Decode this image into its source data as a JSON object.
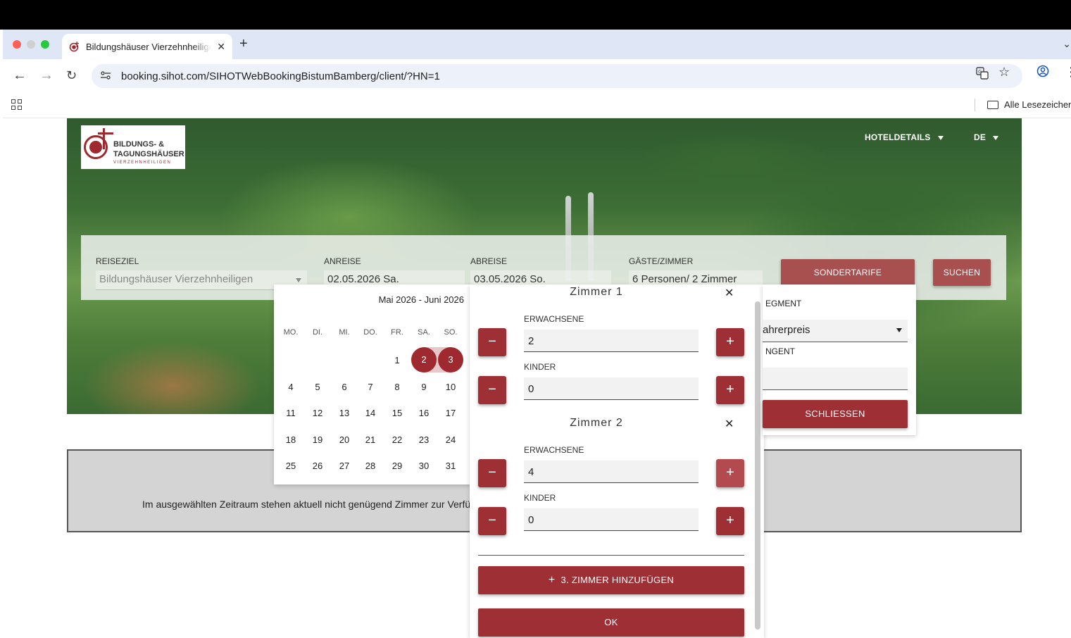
{
  "browser": {
    "tab_title": "Bildungshäuser Vierzehnheiligen",
    "url": "booking.sihot.com/SIHOTWebBookingBistumBamberg/client/?HN=1",
    "bookmarks_folder": "Alle Lesezeichen",
    "colors": {
      "close": "#ff5f57",
      "minimize": "#d0d0d0",
      "maximize": "#28c840"
    }
  },
  "header": {
    "logo_line1": "BILDUNGS- &",
    "logo_line2": "TAGUNGSHÄUSER",
    "logo_line3": "VIERZEHNHEILIGEN",
    "nav_hotel": "HOTELDETAILS",
    "nav_lang": "DE"
  },
  "search": {
    "reiseziel_label": "REISEZIEL",
    "reiseziel_value": "Bildungshäuser Vierzehnheiligen",
    "anreise_label": "ANREISE",
    "anreise_value": "02.05.2026 Sa.",
    "abreise_label": "ABREISE",
    "abreise_value": "03.05.2026 So.",
    "gaeste_label": "GÄSTE/ZIMMER",
    "gaeste_value": "6 Personen/ 2 Zimmer",
    "sondertarife": "SONDERTARIFE",
    "suchen": "SUCHEN"
  },
  "calendar": {
    "heading": "Mai 2026 - Juni 2026",
    "weekdays": [
      "MO.",
      "DI.",
      "MI.",
      "DO.",
      "FR.",
      "SA.",
      "SO."
    ],
    "weeks": [
      [
        "",
        "",
        "",
        "",
        "1",
        "2",
        "3"
      ],
      [
        "4",
        "5",
        "6",
        "7",
        "8",
        "9",
        "10"
      ],
      [
        "11",
        "12",
        "13",
        "14",
        "15",
        "16",
        "17"
      ],
      [
        "18",
        "19",
        "20",
        "21",
        "22",
        "23",
        "24"
      ],
      [
        "25",
        "26",
        "27",
        "28",
        "29",
        "30",
        "31"
      ]
    ],
    "selected": [
      "2",
      "3"
    ],
    "accent": "#9e2a2f"
  },
  "guests": {
    "room1_title": "Zimmer 1",
    "room2_title": "Zimmer 2",
    "adults_label": "ERWACHSENE",
    "children_label": "KINDER",
    "room1_adults": "2",
    "room1_children": "0",
    "room2_adults": "4",
    "room2_children": "0",
    "add_room": "3. ZIMMER HINZUFÜGEN",
    "ok": "OK",
    "close_symbol": "✕",
    "minus": "−",
    "plus": "+"
  },
  "sondertarife_panel": {
    "segment_label": "EGMENT",
    "segment_value": "ahrerpreis",
    "agent_label": "NGENT",
    "agent_value": "",
    "close": "SCHLIESSEN"
  },
  "notice": {
    "text": "Im ausgewählten Zeitraum stehen aktuell nicht genügend Zimmer zur Verfügung."
  }
}
